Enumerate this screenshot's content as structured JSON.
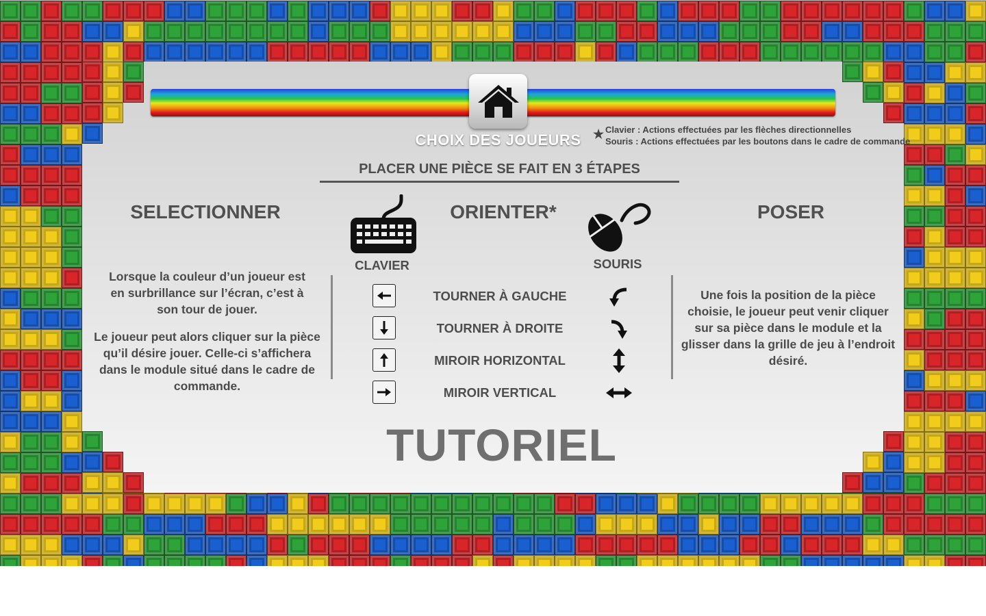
{
  "palette": {
    "red": "#d8252a",
    "green": "#2ea33a",
    "blue": "#1a5fd0",
    "yellow": "#f2cc1a",
    "panel": "#dcdcdc",
    "text": "#4d4d4d"
  },
  "header": {
    "home_icon": "house-icon",
    "menu_title": "CHOIX DES JOUEURS"
  },
  "notes": {
    "star": "★",
    "keyboard": "Clavier : Actions effectuées par les flèches directionnelles",
    "mouse": "Souris : Actions effectuées par les boutons dans le cadre de commande"
  },
  "steps_title": "PLACER UNE PIÈCE SE FAIT EN 3 ÉTAPES",
  "select": {
    "heading": "SELECTIONNER",
    "para1": "Lorsque la couleur d’un joueur est en surbrillance sur l’écran, c’est à son tour de jouer.",
    "para2": "Le joueur peut alors cliquer sur la pièce qu’il désire jouer. Celle-ci s’affichera dans le module situé dans le cadre de commande."
  },
  "orient": {
    "heading": "ORIENTER*",
    "keyboard_label": "CLAVIER",
    "keyboard_icon": "keyboard-icon",
    "mouse_label": "SOURIS",
    "mouse_icon": "mouse-icon",
    "actions": [
      {
        "key": "left-arrow-key-icon",
        "label": "TOURNER À GAUCHE",
        "mouse": "rotate-left-icon"
      },
      {
        "key": "down-arrow-key-icon",
        "label": "TOURNER À DROITE",
        "mouse": "rotate-right-icon"
      },
      {
        "key": "up-arrow-key-icon",
        "label": "MIROIR HORIZONTAL",
        "mouse": "vertical-double-arrow-icon"
      },
      {
        "key": "right-arrow-key-icon",
        "label": "MIROIR VERTICAL",
        "mouse": "horizontal-double-arrow-icon"
      }
    ]
  },
  "place": {
    "heading": "POSER",
    "para": "Une fois la position de la pièce choisie, le joueur peut venir cliquer sur sa pièce dans le module et la glisser dans la grille de jeu à l’endroit désiré."
  },
  "footer_title": "TUTORIEL"
}
